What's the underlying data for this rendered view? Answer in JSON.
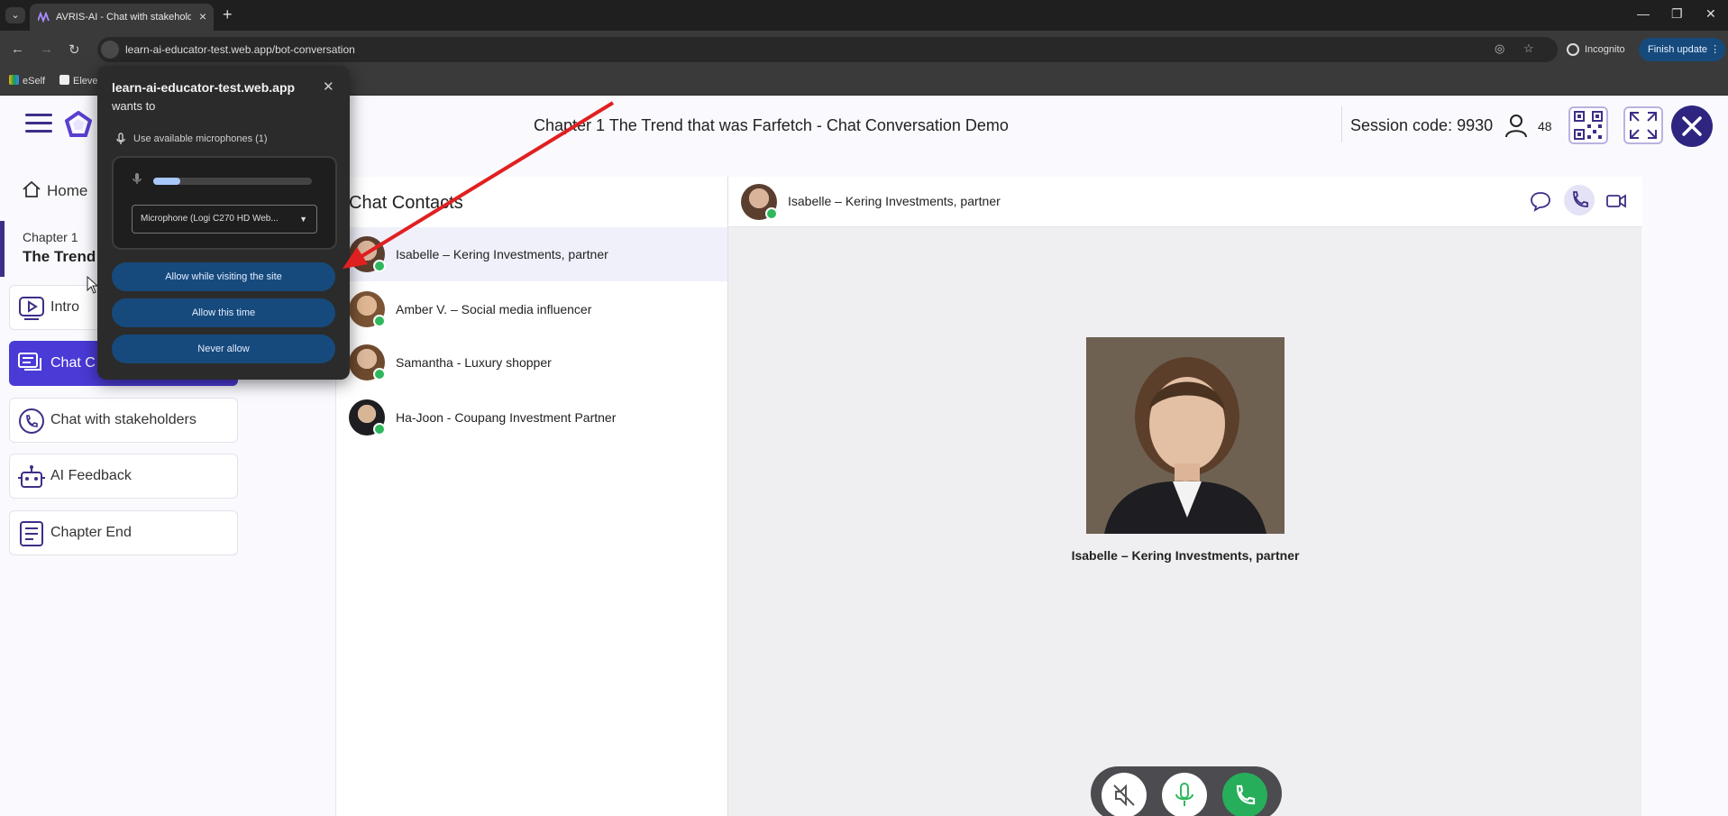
{
  "browser": {
    "tab_title": "AVRIS-AI - Chat with stakeholde",
    "new_tab": "+",
    "url": "learn-ai-educator-test.web.app/bot-conversation",
    "incognito_label": "Incognito",
    "finish_update_label": "Finish update",
    "bookmarks": [
      "eSelf",
      "Eleve"
    ]
  },
  "header": {
    "title": "Chapter 1 The Trend that was Farfetch - Chat Conversation Demo",
    "session_code": "Session code: 9930",
    "user_count": "48"
  },
  "sidebar": {
    "home": "Home",
    "chapter_label": "Chapter 1",
    "chapter_title": "The Trend",
    "items": [
      {
        "label": "Intro",
        "icon": "play-icon"
      },
      {
        "label": "Chat C",
        "icon": "chat-icon",
        "active": true
      },
      {
        "label": "Chat with stakeholders",
        "icon": "phone-icon"
      },
      {
        "label": "AI Feedback",
        "icon": "robot-icon"
      },
      {
        "label": "Chapter End",
        "icon": "document-icon"
      }
    ]
  },
  "contacts": {
    "title": "Chat Contacts",
    "list": [
      {
        "name": "Isabelle – Kering Investments, partner",
        "selected": true
      },
      {
        "name": "Amber V. – Social media influencer"
      },
      {
        "name": "Samantha - Luxury shopper"
      },
      {
        "name": "Ha-Joon - Coupang Investment Partner"
      }
    ]
  },
  "chat": {
    "header_name": "Isabelle – Kering Investments, partner",
    "portrait_caption": "Isabelle – Kering Investments, partner"
  },
  "permission": {
    "site": "learn-ai-educator-test.web.app",
    "wants_to": "wants to",
    "use_mic": "Use available microphones (1)",
    "mic_level": 0.17,
    "mic_device": "Microphone (Logi C270 HD Web...",
    "allow_visit": "Allow while visiting the site",
    "allow_once": "Allow this time",
    "never_allow": "Never allow"
  },
  "colors": {
    "brand": "#3c2f87",
    "active": "#4a3ad6",
    "arrow": "#e02020",
    "online": "#2eb85c",
    "prompt_button": "#174a7c"
  }
}
